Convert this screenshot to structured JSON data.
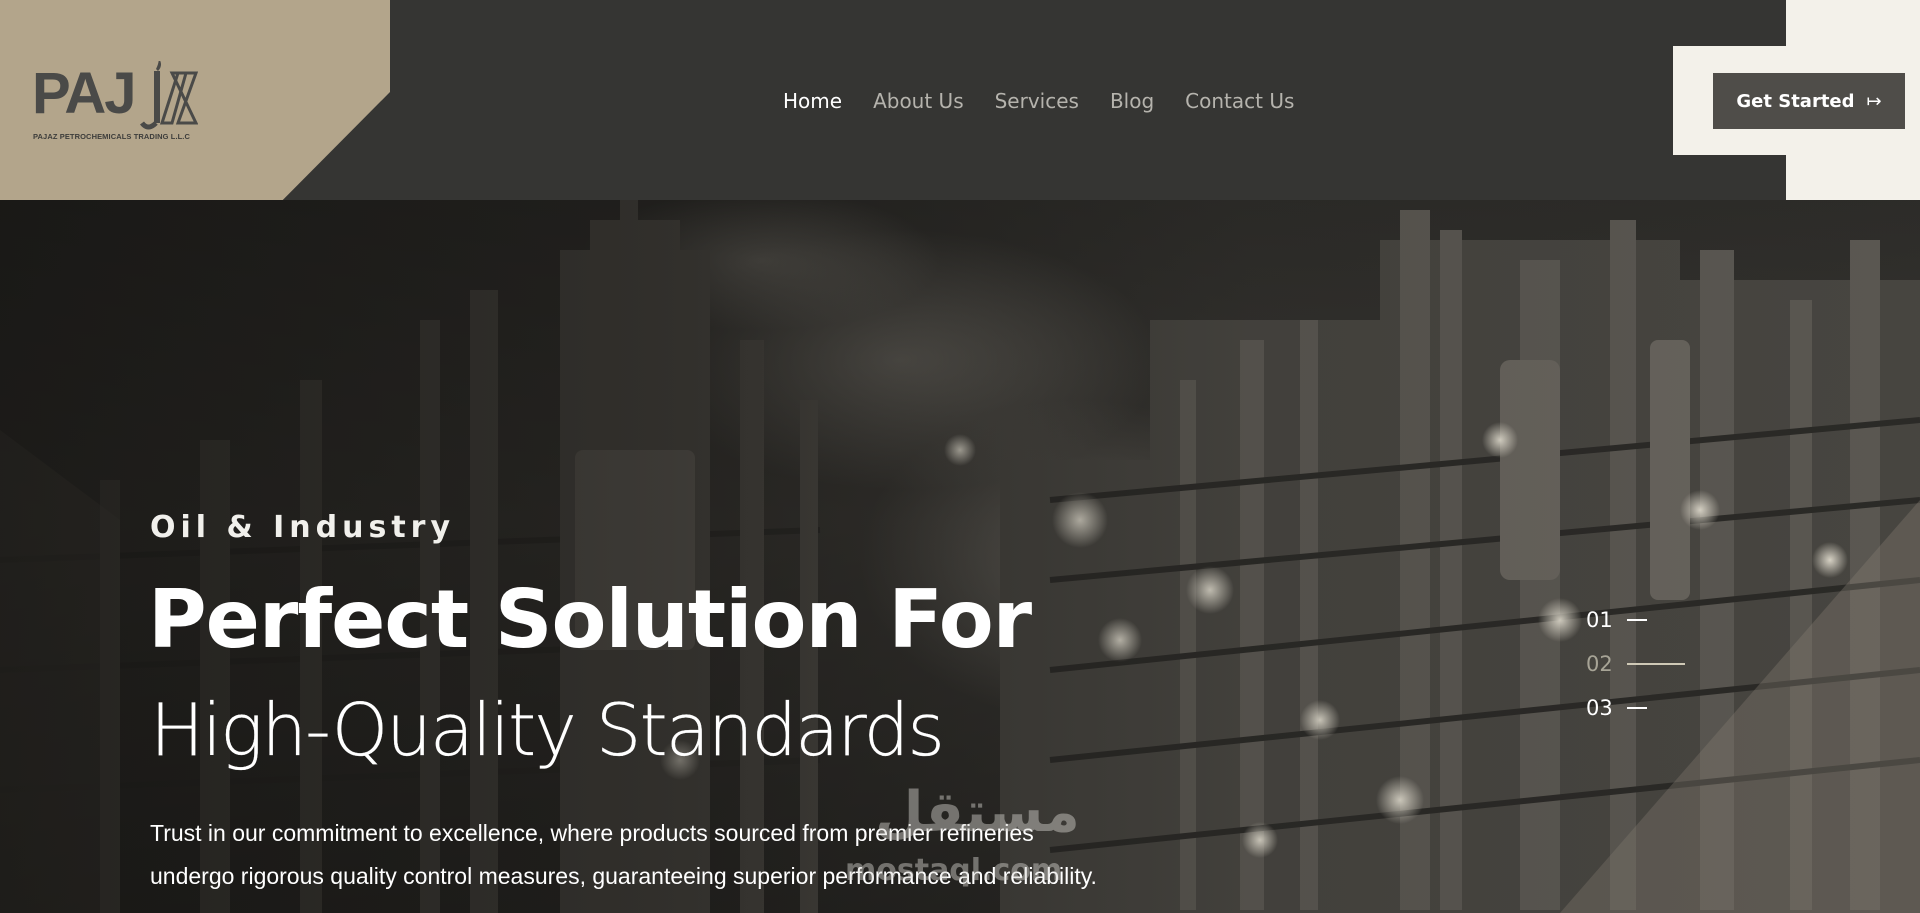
{
  "brand": {
    "logo_text": "PAJ",
    "logo_tagline": "PAJAZ PETROCHEMICALS TRADING L.L.C"
  },
  "nav": {
    "items": [
      {
        "label": "Home",
        "active": true
      },
      {
        "label": "About Us",
        "active": false
      },
      {
        "label": "Services",
        "active": false
      },
      {
        "label": "Blog",
        "active": false
      },
      {
        "label": "Contact Us",
        "active": false
      }
    ]
  },
  "cta": {
    "label": "Get Started",
    "icon": "arrow-right-to-bar-icon"
  },
  "hero": {
    "eyebrow": "Oil & Industry",
    "headline_line1": "Perfect Solution For",
    "headline_line2": "High-Quality Standards",
    "body": "Trust in our commitment to excellence, where products sourced from premier refineries undergo rigorous quality control measures, guaranteeing superior performance and reliability."
  },
  "slider": {
    "items": [
      {
        "label": "01",
        "active": false
      },
      {
        "label": "02",
        "active": true
      },
      {
        "label": "03",
        "active": false
      }
    ]
  },
  "watermark": {
    "arabic": "مستقل",
    "latin": "mostaql.com"
  },
  "colors": {
    "header_bg": "#353533",
    "logo_panel": "#b3a58b",
    "cta_panel": "#f3f1ea",
    "cta_button": "#4f4d49",
    "nav_inactive": "#b5b3ad",
    "nav_active": "#ffffff"
  }
}
